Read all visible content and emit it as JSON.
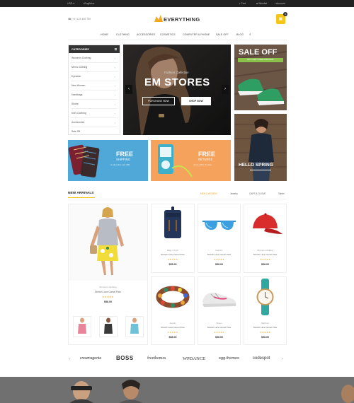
{
  "topbar": {
    "currency": "USD",
    "language": "English",
    "cart": "Cart",
    "wishlist": "Wishlist",
    "account": "Account"
  },
  "header": {
    "phone": "(+1) 123 456 789",
    "logo": "EVERYTHING",
    "cart_count": "0"
  },
  "nav": [
    "HOME",
    "CLOTHING",
    "ACCESSORIES",
    "COSMETICS",
    "COMPUTER & PHONE",
    "SALE OFF",
    "BLOG"
  ],
  "sidebar": {
    "title": "CATEGORIES",
    "items": [
      "Women's Clothing",
      "Men's Clothing",
      "Eyewear",
      "New Women",
      "Handbags",
      "Shoes",
      "Kid's Clothing",
      "Accessories",
      "Sale Off"
    ]
  },
  "slider": {
    "subtitle": "Fashion Collection",
    "title": "EM STORES",
    "btn1": "PURCHASE NOW",
    "btn2": "SHOP NOW"
  },
  "promo_sale": {
    "title": "SALE OFF",
    "sub": "BUY 1 GET 1 FREE DISCOUNT"
  },
  "promo_spring": {
    "title": "HELLO SPRING"
  },
  "promo_shipping": {
    "title": "FREE",
    "sub": "SHIPPING",
    "desc": "on all orders over $99"
  },
  "promo_returns": {
    "title": "FREE",
    "sub": "RETURNS",
    "desc": "return within 30 days"
  },
  "arrivals": {
    "title": "NEW ARRIVALS",
    "tabs": [
      "MEN & WOMEN",
      "Jewelry",
      "CAPS & GLOVE",
      "Tablet"
    ],
    "featured": {
      "category": "Women's Clothing",
      "name": "Stretch Lace Camel Pixie",
      "price": "$58.00"
    },
    "products": [
      {
        "category": "Bags & Tech",
        "name": "Stretch Lace Camel Pixie",
        "price": "$55.00"
      },
      {
        "category": "Fashion",
        "name": "Stretch Lace Camel Pixie",
        "price": "$58.00"
      },
      {
        "category": "Women's Clothing",
        "name": "Stretch Lace Camel Pixie",
        "price": "$58.00"
      },
      {
        "category": "Jewelry",
        "name": "Stretch Lace Camel Pixie",
        "price": "$58.00"
      },
      {
        "category": "Shoes",
        "name": "Stretch Lace Camel Pixie",
        "price": "$58.00"
      },
      {
        "category": "Watches",
        "name": "Stretch Lace Camel Pixie",
        "price": "$58.00"
      }
    ]
  },
  "brands": [
    "crewmagenta",
    "BOSS",
    "freethemes",
    "WPDANCE",
    "egg.themes",
    "codespot"
  ],
  "colors": {
    "accent": "#f5c518",
    "green": "#8bc34a",
    "blue": "#4fa8d8",
    "orange": "#f5a25d",
    "dark": "#222222"
  }
}
